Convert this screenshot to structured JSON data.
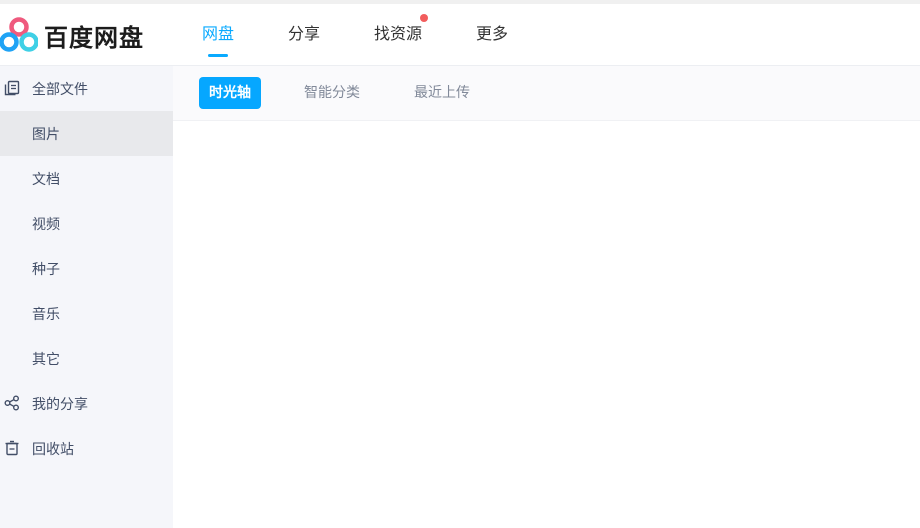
{
  "app": {
    "name": "百度网盘"
  },
  "nav": {
    "items": [
      {
        "label": "网盘",
        "active": true
      },
      {
        "label": "分享",
        "active": false
      },
      {
        "label": "找资源",
        "active": false,
        "badge": true
      },
      {
        "label": "更多",
        "active": false
      }
    ]
  },
  "sidebar": {
    "items": [
      {
        "label": "全部文件",
        "icon": "files-icon",
        "active": false
      },
      {
        "label": "图片",
        "active": true
      },
      {
        "label": "文档",
        "active": false
      },
      {
        "label": "视频",
        "active": false
      },
      {
        "label": "种子",
        "active": false
      },
      {
        "label": "音乐",
        "active": false
      },
      {
        "label": "其它",
        "active": false
      },
      {
        "label": "我的分享",
        "icon": "share-icon",
        "active": false
      },
      {
        "label": "回收站",
        "icon": "trash-icon",
        "active": false
      }
    ]
  },
  "main": {
    "tabs": [
      {
        "label": "时光轴",
        "active": true
      },
      {
        "label": "智能分类",
        "active": false
      },
      {
        "label": "最近上传",
        "active": false
      }
    ]
  },
  "colors": {
    "accent": "#09aaff",
    "tab_active_bg": "#06a7ff",
    "badge": "#f25d5d",
    "sidebar_bg": "#f5f6fa",
    "sidebar_active_bg": "#e8e9ec"
  }
}
